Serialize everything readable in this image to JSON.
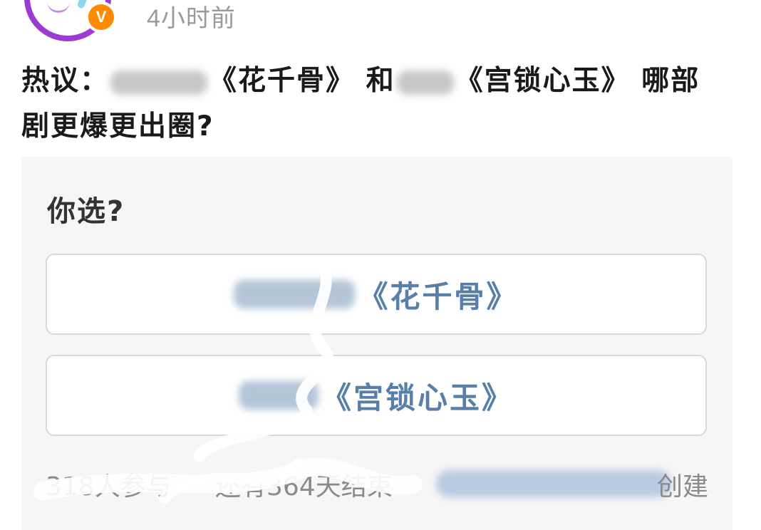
{
  "header": {
    "time": "4小时前",
    "verified_badge": "V",
    "verified_color": "#ff8a00",
    "avatar_ring_color": "#9b3bd0"
  },
  "post": {
    "title_prefix": "热议：",
    "drama_1": "《花千骨》",
    "connector": "和",
    "drama_2": "《宫锁心玉》",
    "title_suffix": "哪部",
    "title_line2": "剧更爆更出圈?"
  },
  "poll": {
    "question": "你选?",
    "options": [
      {
        "label": "《花千骨》"
      },
      {
        "label": "《宫锁心玉》"
      }
    ],
    "participants": "318人参与",
    "remaining": "还有364天结束",
    "created": "创建",
    "option_text_color": "#577fa8"
  }
}
